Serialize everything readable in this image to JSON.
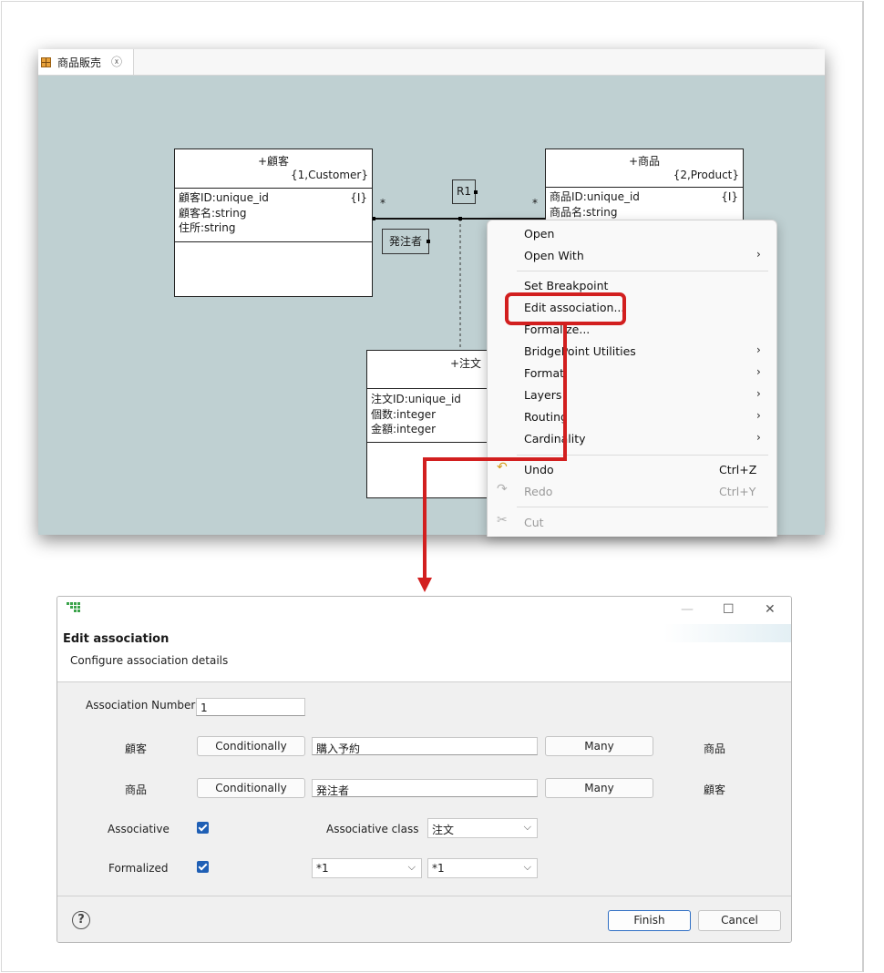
{
  "editor": {
    "tab_title": "商品販売",
    "tab_close": "ⓧ",
    "classes": {
      "customer": {
        "name": "+顧客",
        "key": "{1,Customer}",
        "attrs": [
          "顧客ID:unique_id",
          "顧客名:string",
          "住所:string"
        ],
        "id_mark": "{I}"
      },
      "product": {
        "name": "+商品",
        "key": "{2,Product}",
        "attrs": [
          "商品ID:unique_id",
          "商品名:string"
        ],
        "id_mark": "{I}"
      },
      "order": {
        "name": "+注文",
        "attrs": [
          "注文ID:unique_id",
          "個数:integer",
          "金額:integer"
        ]
      }
    },
    "assoc_label": "R1",
    "role_label": "発注者",
    "mult_left": "*",
    "mult_right": "*"
  },
  "context_menu": {
    "items": [
      {
        "label": "Open"
      },
      {
        "label": "Open With",
        "arrow": "›"
      },
      {
        "label": "Set Breakpoint"
      },
      {
        "label": "Edit association..."
      },
      {
        "label": "Formalize..."
      },
      {
        "label": "BridgePoint Utilities",
        "arrow": "›"
      },
      {
        "label": "Format",
        "arrow": "›"
      },
      {
        "label": "Layers",
        "arrow": "›"
      },
      {
        "label": "Routing",
        "arrow": "›"
      },
      {
        "label": "Cardinality",
        "arrow": "›"
      },
      {
        "label": "Undo",
        "shortcut": "Ctrl+Z",
        "icon": "undo-icon"
      },
      {
        "label": "Redo",
        "shortcut": "Ctrl+Y",
        "icon": "redo-icon",
        "disabled": true
      },
      {
        "label": "Cut",
        "icon": "scissors-icon",
        "disabled": true
      }
    ],
    "highlight_color": "#d21f1f"
  },
  "dialog": {
    "title": "Edit association",
    "subtitle": "Configure association details",
    "window_buttons": {
      "minimize": "—",
      "maximize": "☐",
      "close": "✕"
    },
    "association_number_label": "Association Number",
    "association_number": "1",
    "row1": {
      "class_left": "顧客",
      "conditionality": "Conditionally",
      "phrase": "購入予約",
      "multiplicity": "Many",
      "class_right": "商品"
    },
    "row2": {
      "class_left": "商品",
      "conditionality": "Conditionally",
      "phrase": "発注者",
      "multiplicity": "Many",
      "class_right": "顧客"
    },
    "associative_label": "Associative",
    "associative_checked": true,
    "associative_class_label": "Associative class",
    "associative_class": "注文",
    "formalized_label": "Formalized",
    "formalized_checked": true,
    "formalize_left": "*1",
    "formalize_right": "*1",
    "help": "?",
    "finish": "Finish",
    "cancel": "Cancel",
    "accent_color": "#1f5fb5"
  }
}
